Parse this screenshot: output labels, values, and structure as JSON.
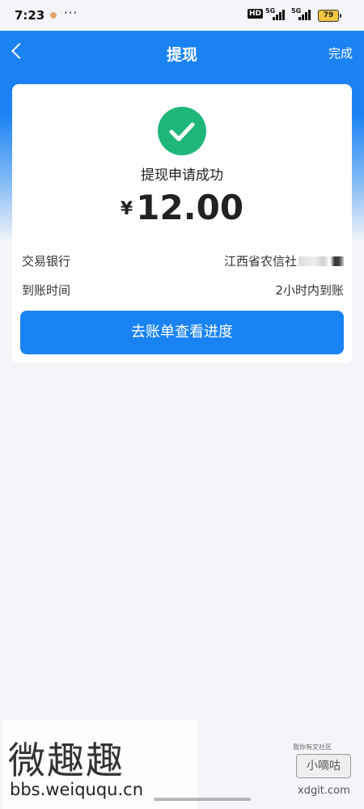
{
  "status_bar": {
    "time": "7:23",
    "more": "···",
    "hd": "HD",
    "signal1": "5G",
    "signal2": "5G",
    "battery": "79"
  },
  "nav": {
    "back_icon": "chevron-left-icon",
    "title": "提现",
    "done_label": "完成"
  },
  "result": {
    "icon": "check-circle-icon",
    "status_text": "提现申请成功",
    "currency": "¥",
    "amount": "12.00"
  },
  "details": [
    {
      "label": "交易银行",
      "value": "江西省农信社"
    },
    {
      "label": "到账时间",
      "value": "2小时内到账"
    }
  ],
  "action_button": "去账单查看进度",
  "watermark": {
    "left_big": "微趣趣",
    "left_url": "bbs.weiququ.cn",
    "right_small": "我你有文社区",
    "right_logo": "小嘀咕",
    "right_url": "xdgit.com"
  },
  "colors": {
    "primary": "#1a83f4",
    "success": "#1fb67a",
    "background": "#f4f5f8"
  }
}
